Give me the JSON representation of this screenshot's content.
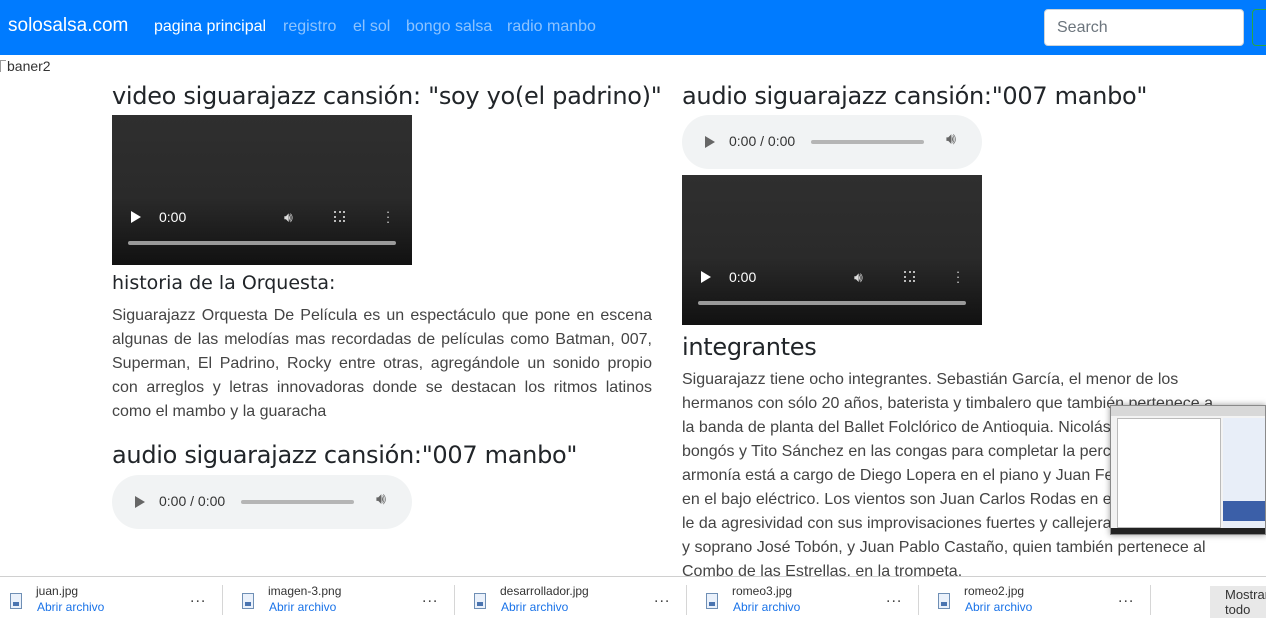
{
  "navbar": {
    "brand": "solosalsa.com",
    "links": [
      "pagina principal",
      "registro",
      "el sol",
      "bongo salsa",
      "radio manbo"
    ],
    "search_placeholder": "Search",
    "bg_color": "#007bff"
  },
  "banner_alt": "baner2",
  "left": {
    "video_title": "video siguarajazz cansión: \"soy yo(el padrino)\"",
    "video_time": "0:00",
    "history_title": "historia de la Orquesta:",
    "history_text": "Siguarajazz Orquesta De Película es un espectáculo que pone en escena algunas de las melodías mas recordadas de películas como Batman, 007, Superman, El Padrino, Rocky entre otras, agregándole un sonido propio con arreglos y letras innovadoras donde se destacan los ritmos latinos como el mambo y la guaracha",
    "audio_title": "audio siguarajazz cansión:\"007 manbo\"",
    "audio_time": "0:00 / 0:00"
  },
  "right": {
    "audio_title": "audio siguarajazz cansión:\"007 manbo\"",
    "audio_time": "0:00 / 0:00",
    "video_time": "0:00",
    "members_title": "integrantes",
    "members_lines": [
      "Siguarajazz tiene ocho integrantes. Sebastián García, el menor de los",
      "hermanos con sólo 20 años, baterista y timbalero que también pertenece a",
      "la banda de planta del Ballet Folclórico de Antioquia. Nicolás",
      "bongós y Tito Sánchez en las congas para completar la percu",
      "armonía está a cargo de Diego Lopera en el piano y Juan Fer",
      "en el bajo eléctrico. Los vientos son Juan Carlos Rodas en el t",
      "le da agresividad con sus improvisaciones fuertes y callejeras,",
      "y soprano José Tobón, y Juan Pablo Castaño, quien también pertenece al",
      "Combo de las Estrellas, en la trompeta."
    ]
  },
  "downloads": {
    "open_label": "Abrir archivo",
    "more_label": "...",
    "items": [
      "juan.jpg",
      "imagen-3.png",
      "desarrollador.jpg",
      "romeo3.jpg",
      "romeo2.jpg"
    ],
    "show_all_label": "Mostrar todo"
  }
}
